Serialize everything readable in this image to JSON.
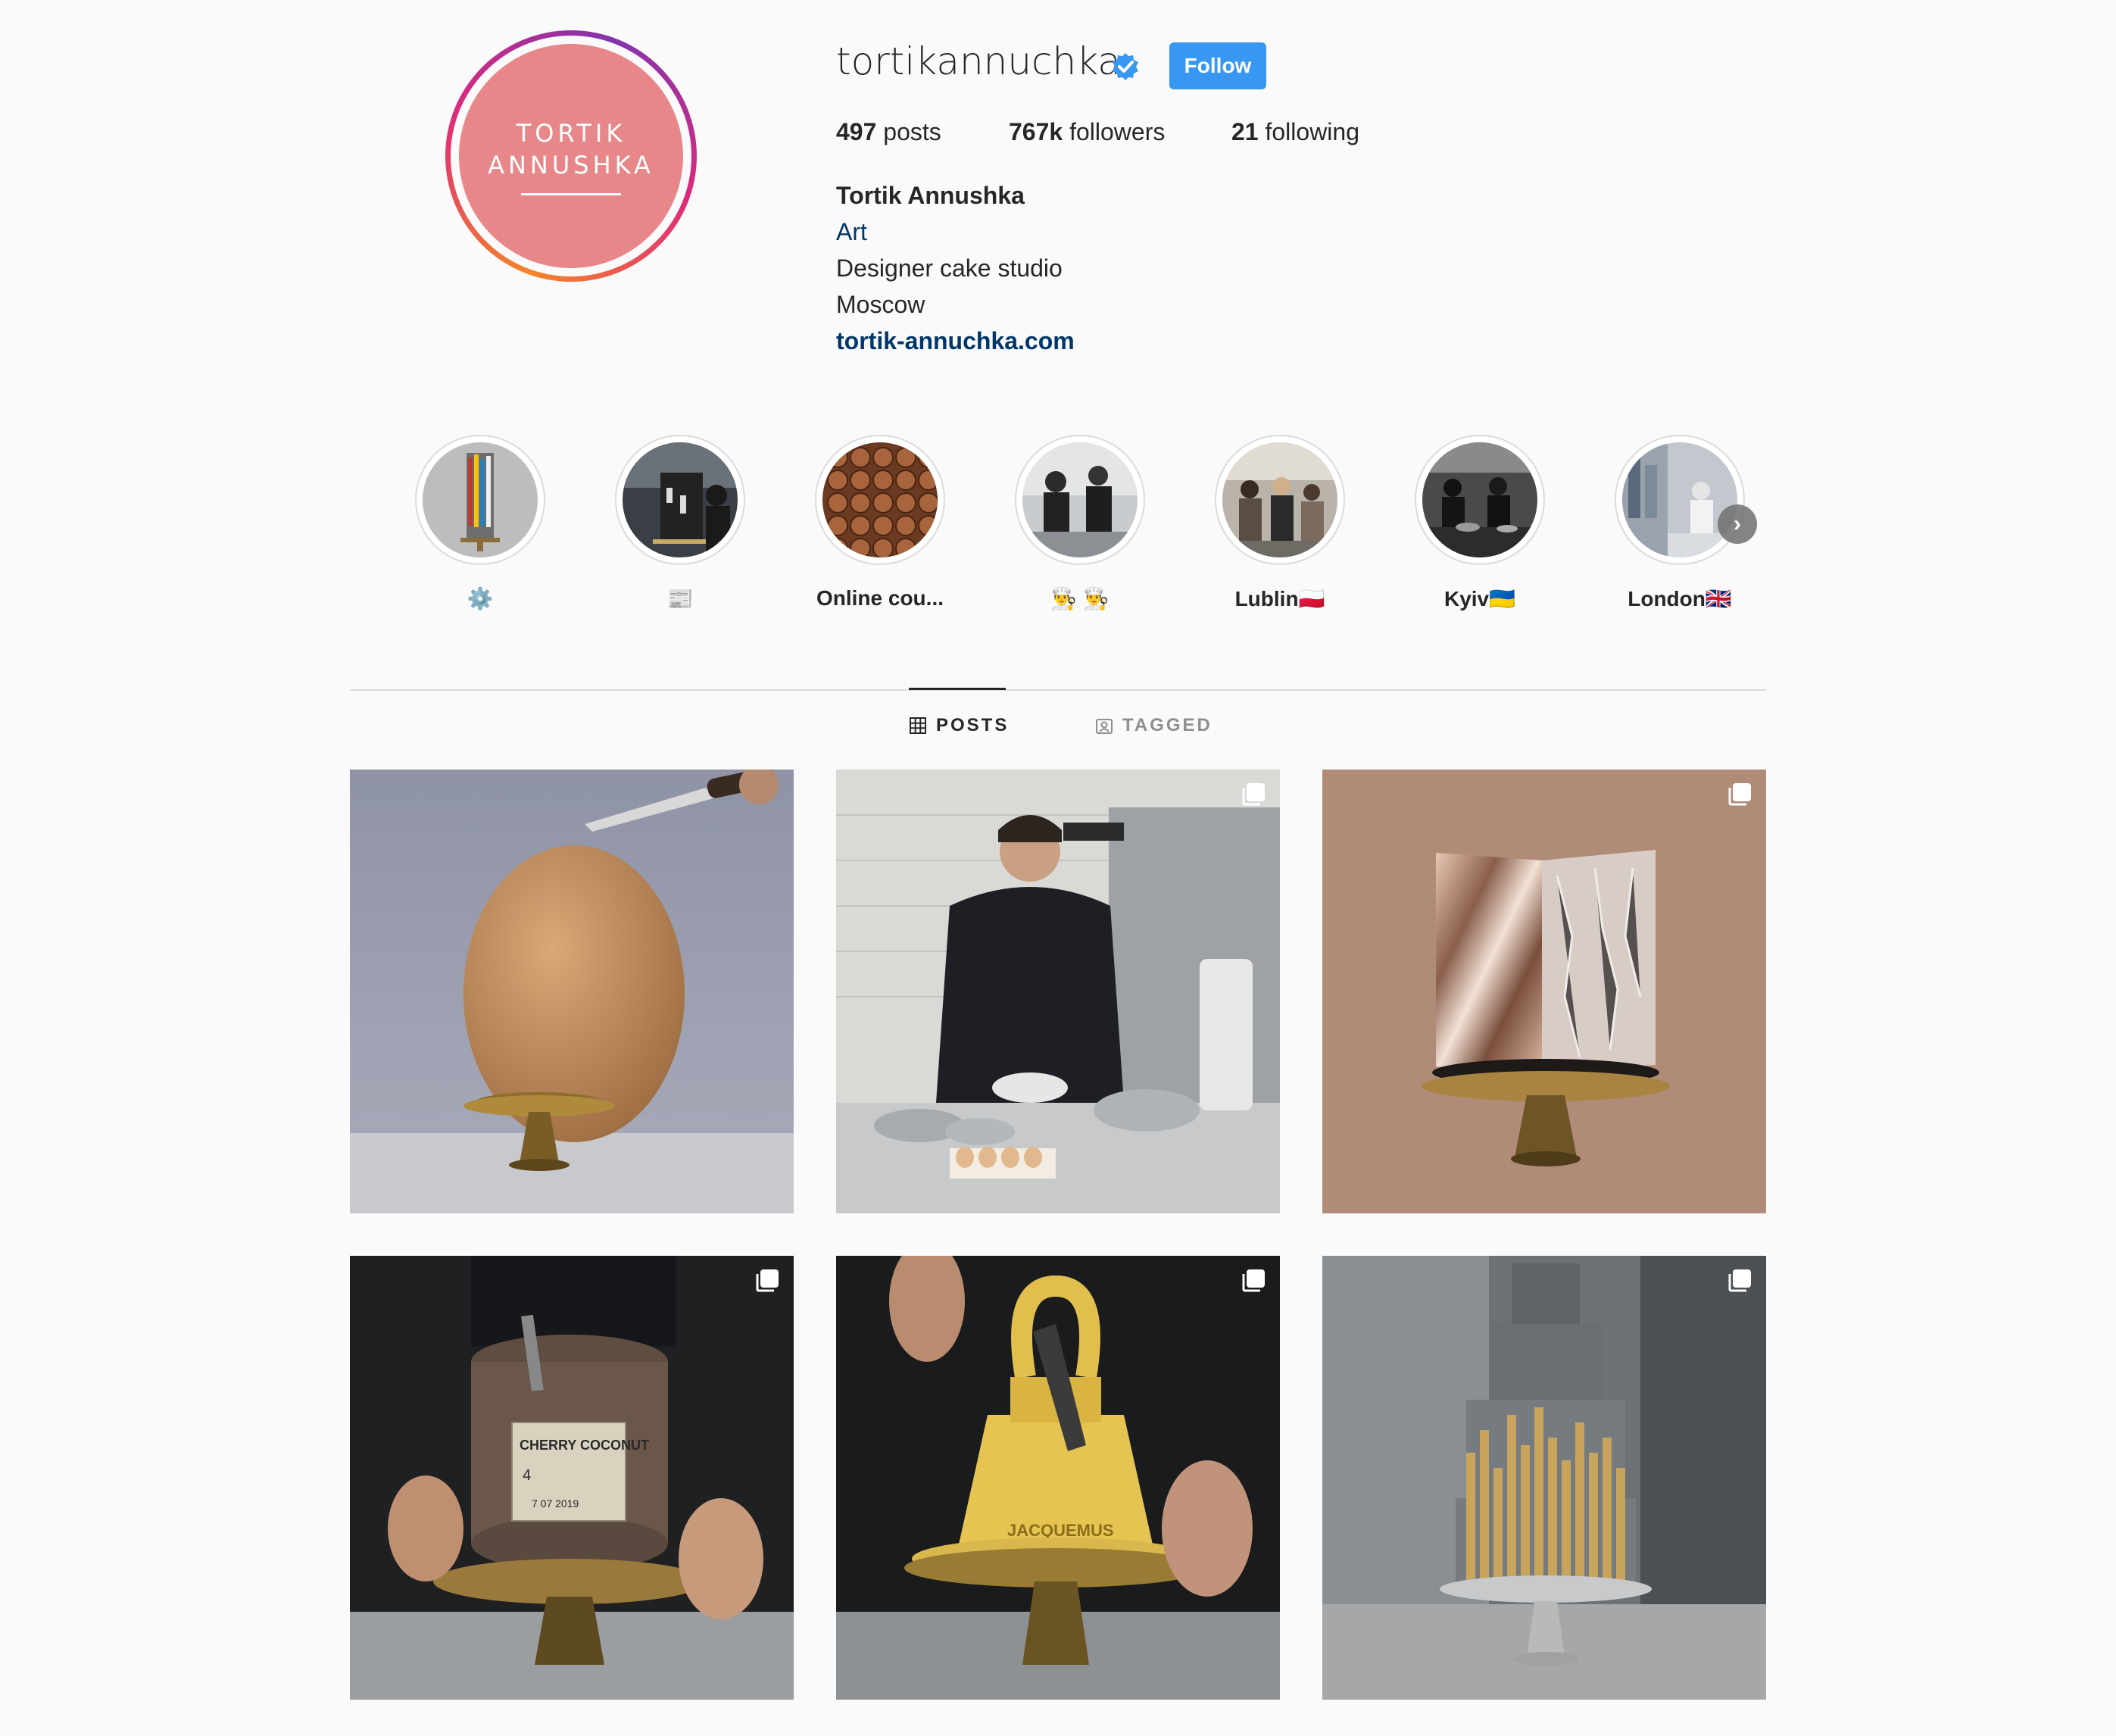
{
  "profile": {
    "username": "tortikannuchka",
    "verified": true,
    "follow_label": "Follow",
    "avatar_text": [
      "TORTIK",
      "ANNUSHKA"
    ],
    "stats": {
      "posts_count": "497",
      "posts_label": "posts",
      "followers_count": "767k",
      "followers_label": "followers",
      "following_count": "21",
      "following_label": "following"
    },
    "bio": {
      "full_name": "Tortik Annushka",
      "category": "Art",
      "description": "Designer cake studio",
      "city": "Moscow",
      "website": "tortik-annuchka.com"
    }
  },
  "highlights": [
    {
      "label": "⚙️"
    },
    {
      "label": "📰"
    },
    {
      "label": "Online cou..."
    },
    {
      "label": "👨‍🍳 👨‍🍳"
    },
    {
      "label": "Lublin🇵🇱"
    },
    {
      "label": "Kyiv🇺🇦"
    },
    {
      "label": "London🇬🇧"
    }
  ],
  "tabs": {
    "posts": "POSTS",
    "tagged": "TAGGED"
  },
  "posts": [
    {
      "subject": "egg-shaped cake on gold stand with knife",
      "multi": false
    },
    {
      "subject": "baker sifting flour in kitchen",
      "multi": true
    },
    {
      "subject": "copper foil square cake on gold stand",
      "multi": true
    },
    {
      "subject": "can-shaped cake labeled CHERRY COCONUT",
      "multi": true,
      "label_text": [
        "CHERRY COCONUT",
        "4",
        "7 07 2019"
      ]
    },
    {
      "subject": "yellow JACQUEMUS bag cake being cut",
      "multi": true,
      "label_text": [
        "JACQUEMUS"
      ]
    },
    {
      "subject": "grey tiered cake with gold bars",
      "multi": true
    }
  ],
  "colors": {
    "accent": "#3897f0",
    "link": "#00376b",
    "avatar_bg": "#e8878a",
    "background": "#fafafa",
    "muted": "#8e8e8e"
  }
}
